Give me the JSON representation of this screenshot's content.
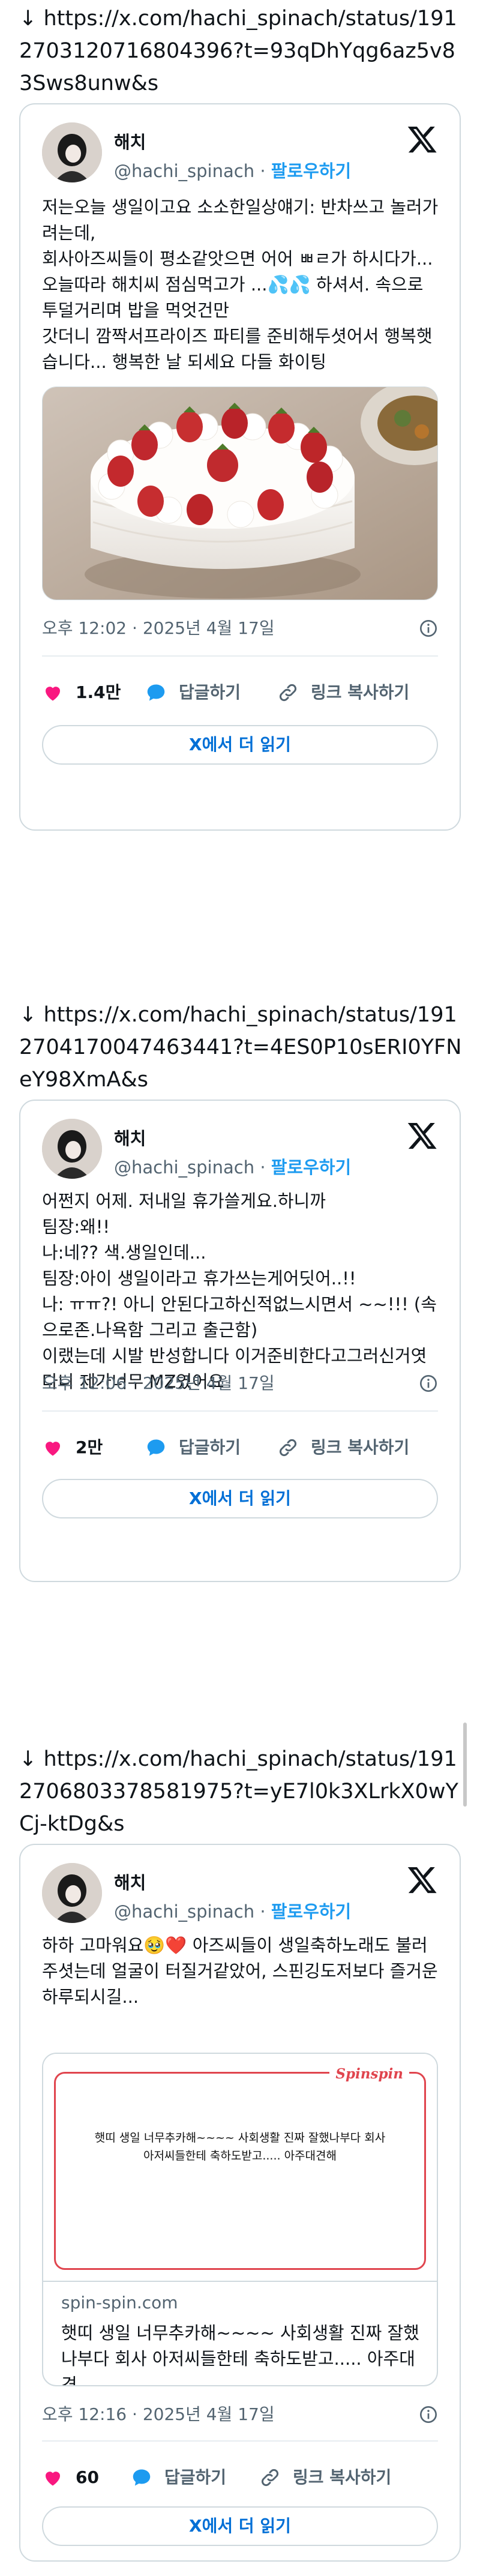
{
  "colors": {
    "accent": "#1d9bf0",
    "link": "#006fd6",
    "heart": "#f91880",
    "muted": "#536471",
    "border": "#cfd9de"
  },
  "icons": {
    "like": "heart-icon",
    "reply": "speech-bubble-icon",
    "copy_link": "link-icon",
    "brand": "x-logo-icon",
    "info": "info-icon"
  },
  "posts": [
    {
      "url": "↓ https://x.com/hachi_spinach/status/1912703120716804396?t=93qDhYqg6az5v83Sws8unw&s",
      "name": "해치",
      "handle": "@hachi_spinach",
      "separator": "·",
      "follow": "팔로우하기",
      "text": "저는오늘 생일이고요  소소한일상얘기: 반차쓰고 놀러가려는데,\n회사아즈씨들이 평소같앗으면 어어 ㅃㄹ가 하시다가...\n오늘따라 해치씨   점심먹고가 ...💦💦 하셔서. 속으로 투덜거리며 밥을 먹엇건만\n갓더니 깜짝서프라이즈 파티를 준비해두셧어서 행복햇습니다... 행복한 날 되세요 다들   화이팅",
      "timestamp": "오후 12:02 · 2025년 4월 17일",
      "likes": "1.4만",
      "reply": "답글하기",
      "copy_link": "링크 복사하기",
      "read_more": "X에서 더 읽기"
    },
    {
      "url": "↓ https://x.com/hachi_spinach/status/1912704170047463441?t=4ES0P10sERI0YFNeY98XmA&s",
      "name": "해치",
      "handle": "@hachi_spinach",
      "separator": "·",
      "follow": "팔로우하기",
      "text": "어쩐지 어제. 저내일 휴가쓸게요.하니까\n팀장:왜!!\n나:네?? 색.생일인데...\n팀장:아이 생일이라고  휴가쓰는게어딧어..!!\n나:  ㅠㅠ?! 아니 안된다고하신적없느시면서 ~~!!! (속으로존.나욕함  그리고 출근함)\n이랬는데  시발 반성합니다 이거준비한다고그러신거엿다니 제가너무 MZ였어요",
      "timestamp": "오후 12:06 · 2025년 4월 17일",
      "likes": "2만",
      "reply": "답글하기",
      "copy_link": "링크 복사하기",
      "read_more": "X에서 더 읽기"
    },
    {
      "url": "↓ https://x.com/hachi_spinach/status/1912706803378581975?t=yE7l0k3XLrkX0wYCj-ktDg&s",
      "name": "해치",
      "handle": "@hachi_spinach",
      "separator": "·",
      "follow": "팔로우하기",
      "text": "하하 고마워요🥹❤️ 아즈씨들이 생일축하노래도 불러주셧는데 얼굴이 터질거같았어, 스핀깅도저보다 즐거운 하루되시길...",
      "link_card": {
        "brand": "Spinspin",
        "image_text": "햇띠 생일 너무추카해~~~~ 사회생활 진짜 잘했나부다 회사\n아저씨들한테 축하도받고..... 아주대견해",
        "domain": "spin-spin.com",
        "description": "햇띠 생일 너무추카해~~~~ 사회생활 진짜 잘했나부다 회사 아저씨들한테 축하도받고..... 아주대견..."
      },
      "timestamp": "오후 12:16 · 2025년 4월 17일",
      "likes": "60",
      "reply": "답글하기",
      "copy_link": "링크 복사하기",
      "read_more": "X에서 더 읽기"
    }
  ]
}
